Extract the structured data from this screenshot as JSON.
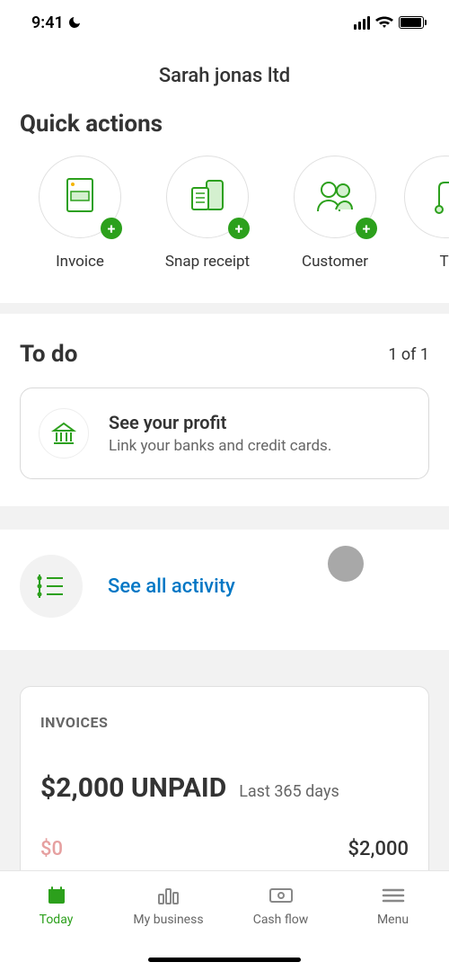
{
  "status": {
    "time": "9:41"
  },
  "header": {
    "company": "Sarah jonas ltd"
  },
  "quick": {
    "title": "Quick actions",
    "items": [
      {
        "label": "Invoice"
      },
      {
        "label": "Snap receipt"
      },
      {
        "label": "Customer"
      },
      {
        "label": "Trac"
      }
    ]
  },
  "todo": {
    "title": "To do",
    "count": "1 of 1",
    "card": {
      "title": "See your profit",
      "subtitle": "Link your banks and credit cards."
    }
  },
  "activity": {
    "link": "See all activity"
  },
  "invoices": {
    "label": "INVOICES",
    "amount": "$2,000 UNPAID",
    "range": "Last 365 days",
    "min": "$0",
    "max": "$2,000"
  },
  "nav": {
    "today": "Today",
    "business": "My business",
    "cashflow": "Cash flow",
    "menu": "Menu"
  }
}
